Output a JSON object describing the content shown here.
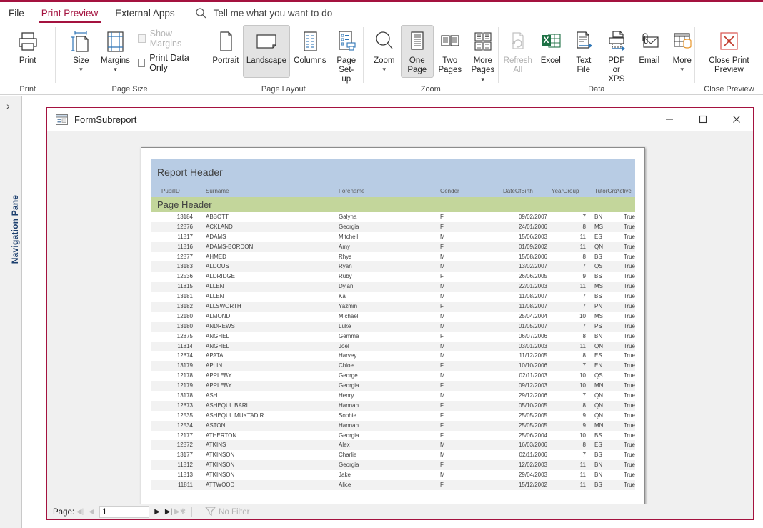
{
  "window": {
    "title": "FormSubreport",
    "file_icon": "form-icon"
  },
  "tabs": [
    {
      "label": "File",
      "active": false
    },
    {
      "label": "Print Preview",
      "active": true
    },
    {
      "label": "External Apps",
      "active": false
    }
  ],
  "search": {
    "placeholder": "Tell me what you want to do",
    "icon": "search-icon"
  },
  "ribbon": {
    "groups": [
      {
        "label": "Print",
        "buttons": [
          {
            "label": "Print",
            "icon": "printer-icon",
            "state": "normal"
          }
        ]
      },
      {
        "label": "Page Size",
        "buttons": [
          {
            "label": "Size",
            "icon": "page-size-icon",
            "state": "normal",
            "dropdown": true
          },
          {
            "label": "Margins",
            "icon": "margins-icon",
            "state": "normal",
            "dropdown": true
          }
        ],
        "checkboxes": [
          {
            "label": "Show Margins",
            "checked": false,
            "disabled": true
          },
          {
            "label": "Print Data Only",
            "checked": false,
            "disabled": false
          }
        ]
      },
      {
        "label": "Page Layout",
        "buttons": [
          {
            "label": "Portrait",
            "icon": "portrait-icon",
            "state": "normal"
          },
          {
            "label": "Landscape",
            "icon": "landscape-icon",
            "state": "selected"
          },
          {
            "label": "Columns",
            "icon": "columns-icon",
            "state": "normal"
          },
          {
            "label": "Page\nSet-up",
            "icon": "page-setup-icon",
            "state": "normal"
          }
        ]
      },
      {
        "label": "Zoom",
        "buttons": [
          {
            "label": "Zoom",
            "icon": "magnifier-icon",
            "state": "normal",
            "dropdown": true
          },
          {
            "label": "One\nPage",
            "icon": "one-page-icon",
            "state": "selected"
          },
          {
            "label": "Two\nPages",
            "icon": "two-pages-icon",
            "state": "normal"
          },
          {
            "label": "More\nPages",
            "icon": "more-pages-icon",
            "state": "normal",
            "dropdown_inline": true
          }
        ]
      },
      {
        "label": "Data",
        "buttons": [
          {
            "label": "Refresh\nAll",
            "icon": "refresh-icon",
            "state": "disabled"
          },
          {
            "label": "Excel",
            "icon": "excel-icon",
            "state": "normal"
          },
          {
            "label": "Text\nFile",
            "icon": "text-file-icon",
            "state": "normal"
          },
          {
            "label": "PDF\nor XPS",
            "icon": "pdf-icon",
            "state": "normal"
          },
          {
            "label": "Email",
            "icon": "email-icon",
            "state": "normal"
          },
          {
            "label": "More",
            "icon": "more-data-icon",
            "state": "normal",
            "dropdown": true
          }
        ]
      },
      {
        "label": "Close Preview",
        "buttons": [
          {
            "label": "Close Print\nPreview",
            "icon": "close-x-icon",
            "state": "normal"
          }
        ]
      }
    ]
  },
  "navigation_pane": {
    "label": "Navigation Pane",
    "expand_icon": "chevron-right-icon"
  },
  "window_controls": {
    "minimize": "minimize-icon",
    "maximize": "maximize-icon",
    "close": "close-icon"
  },
  "report": {
    "report_header_label": "Report Header",
    "page_header_label": "Page Header",
    "header_colors": {
      "report_header_bg": "#b8cce4",
      "page_header_bg": "#c3d69b"
    },
    "columns": [
      "PupilID",
      "Surname",
      "Forename",
      "Gender",
      "DateOfBirth",
      "YearGroup",
      "TutorGro",
      "Active"
    ],
    "rows": [
      [
        "13184",
        "ABBOTT",
        "Galyna",
        "F",
        "09/02/2007",
        "7",
        "BN",
        "True"
      ],
      [
        "12876",
        "ACKLAND",
        "Georgia",
        "F",
        "24/01/2006",
        "8",
        "MS",
        "True"
      ],
      [
        "11817",
        "ADAMS",
        "Mitchell",
        "M",
        "15/06/2003",
        "11",
        "ES",
        "True"
      ],
      [
        "11816",
        "ADAMS-BORDON",
        "Amy",
        "F",
        "01/09/2002",
        "11",
        "QN",
        "True"
      ],
      [
        "12877",
        "AHMED",
        "Rhys",
        "M",
        "15/08/2006",
        "8",
        "BS",
        "True"
      ],
      [
        "13183",
        "ALDOUS",
        "Ryan",
        "M",
        "13/02/2007",
        "7",
        "QS",
        "True"
      ],
      [
        "12536",
        "ALDRIDGE",
        "Ruby",
        "F",
        "26/06/2005",
        "9",
        "BS",
        "True"
      ],
      [
        "11815",
        "ALLEN",
        "Dylan",
        "M",
        "22/01/2003",
        "11",
        "MS",
        "True"
      ],
      [
        "13181",
        "ALLEN",
        "Kai",
        "M",
        "11/08/2007",
        "7",
        "BS",
        "True"
      ],
      [
        "13182",
        "ALLSWORTH",
        "Yazmin",
        "F",
        "11/08/2007",
        "7",
        "PN",
        "True"
      ],
      [
        "12180",
        "ALMOND",
        "Michael",
        "M",
        "25/04/2004",
        "10",
        "MS",
        "True"
      ],
      [
        "13180",
        "ANDREWS",
        "Luke",
        "M",
        "01/05/2007",
        "7",
        "PS",
        "True"
      ],
      [
        "12875",
        "ANGHEL",
        "Gemma",
        "F",
        "06/07/2006",
        "8",
        "BN",
        "True"
      ],
      [
        "11814",
        "ANGHEL",
        "Joel",
        "M",
        "03/01/2003",
        "11",
        "QN",
        "True"
      ],
      [
        "12874",
        "APATA",
        "Harvey",
        "M",
        "11/12/2005",
        "8",
        "ES",
        "True"
      ],
      [
        "13179",
        "APLIN",
        "Chloe",
        "F",
        "10/10/2006",
        "7",
        "EN",
        "True"
      ],
      [
        "12178",
        "APPLEBY",
        "George",
        "M",
        "02/11/2003",
        "10",
        "QS",
        "True"
      ],
      [
        "12179",
        "APPLEBY",
        "Georgia",
        "F",
        "09/12/2003",
        "10",
        "MN",
        "True"
      ],
      [
        "13178",
        "ASH",
        "Henry",
        "M",
        "29/12/2006",
        "7",
        "QN",
        "True"
      ],
      [
        "12873",
        "ASHEQUL BARI",
        "Hannah",
        "F",
        "05/10/2005",
        "8",
        "QN",
        "True"
      ],
      [
        "12535",
        "ASHEQUL MUKTADIR",
        "Sophie",
        "F",
        "25/05/2005",
        "9",
        "QN",
        "True"
      ],
      [
        "12534",
        "ASTON",
        "Hannah",
        "F",
        "25/05/2005",
        "9",
        "MN",
        "True"
      ],
      [
        "12177",
        "ATHERTON",
        "Georgia",
        "F",
        "25/06/2004",
        "10",
        "BS",
        "True"
      ],
      [
        "12872",
        "ATKINS",
        "Alex",
        "M",
        "16/03/2006",
        "8",
        "ES",
        "True"
      ],
      [
        "13177",
        "ATKINSON",
        "Charlie",
        "M",
        "02/11/2006",
        "7",
        "BS",
        "True"
      ],
      [
        "11812",
        "ATKINSON",
        "Georgia",
        "F",
        "12/02/2003",
        "11",
        "BN",
        "True"
      ],
      [
        "11813",
        "ATKINSON",
        "Jake",
        "M",
        "29/04/2003",
        "11",
        "BN",
        "True"
      ],
      [
        "11811",
        "ATTWOOD",
        "Alice",
        "F",
        "15/12/2002",
        "11",
        "BS",
        "True"
      ]
    ]
  },
  "statusbar": {
    "page_label": "Page:",
    "page_value": "1",
    "first_icon": "first-page-icon",
    "prev_icon": "prev-page-icon",
    "next_icon": "next-page-icon",
    "last_icon": "last-page-icon",
    "new_icon": "new-page-icon",
    "filter_label": "No Filter",
    "filter_icon": "filter-icon"
  }
}
